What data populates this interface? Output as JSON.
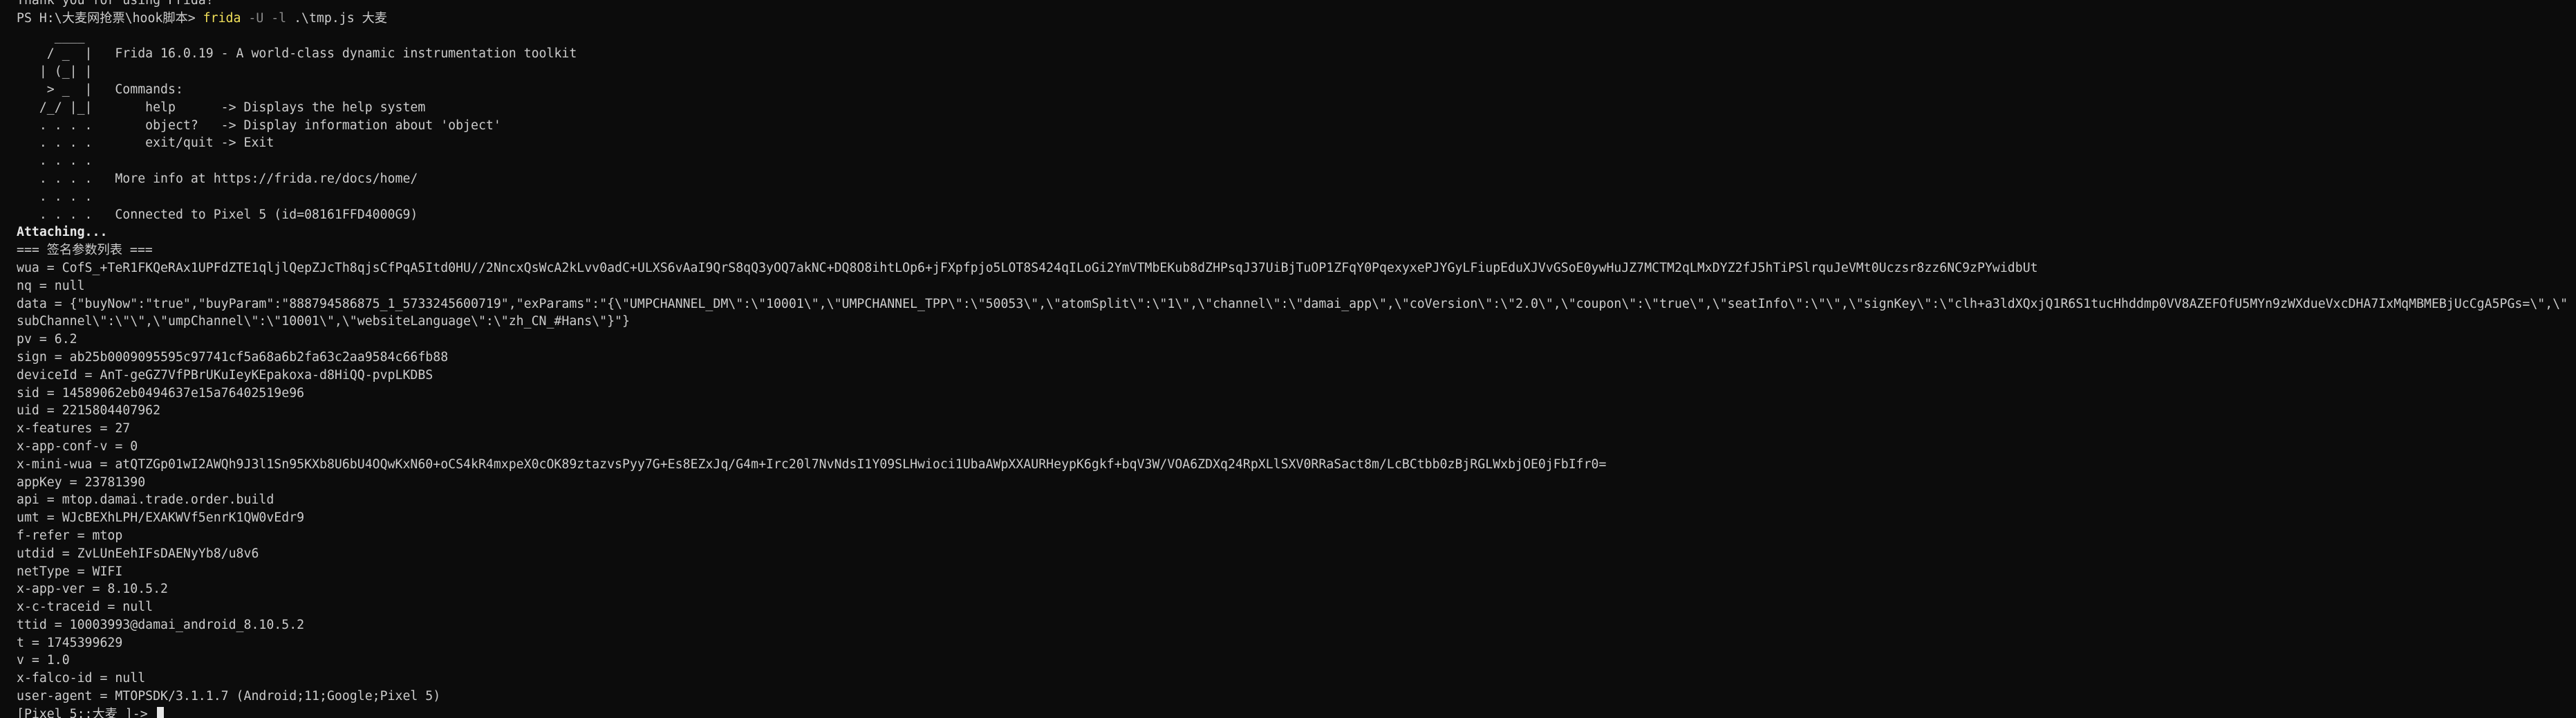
{
  "terminal": {
    "prev_line": "Thank you for using Frida!",
    "prompt": "PS H:\\大麦网抢票\\hook脚本> ",
    "command": {
      "name": "frida",
      "flag1": " -U -l",
      "rest": " .\\tmp.js 大麦"
    }
  },
  "banner": [
    {
      "art": "     ____   ",
      "text": ""
    },
    {
      "art": "    / _  |  ",
      "text": " Frida 16.0.19 - A world-class dynamic instrumentation toolkit"
    },
    {
      "art": "   | (_| |  ",
      "text": ""
    },
    {
      "art": "    > _  |  ",
      "text": " Commands:"
    },
    {
      "art": "   /_/ |_|  ",
      "text": "     help      -> Displays the help system"
    },
    {
      "art": "   . . . .  ",
      "text": "     object?   -> Display information about 'object'"
    },
    {
      "art": "   . . . .  ",
      "text": "     exit/quit -> Exit"
    },
    {
      "art": "   . . . .  ",
      "text": ""
    },
    {
      "art": "   . . . .  ",
      "text": " More info at https://frida.re/docs/home/"
    },
    {
      "art": "   . . . .  ",
      "text": ""
    },
    {
      "art": "   . . . .  ",
      "text": " Connected to Pixel 5 (id=08161FFD4000G9)"
    }
  ],
  "attaching": "Attaching...",
  "section_header": "=== 签名参数列表 ===",
  "output_lines": [
    "wua = CofS_+TeR1FKQeRAx1UPFdZTE1qljlQepZJcTh8qjsCfPqA5Itd0HU//2NncxQsWcA2kLvv0adC+ULXS6vAaI9QrS8qQ3yOQ7akNC+DQ8O8ihtLOp6+jFXpfpjo5LOT8S424qILoGi2YmVTMbEKub8dZHPsqJ37UiBjTuOP1ZFqY0PqexyxePJYGyLFiupEduXJVvGSoE0ywHuJZ7MCTM2qLMxDYZ2fJ5hTiPSlrquJeVMt0Uczsr8zz6NC9zPYwidbUt",
    "nq = null",
    "data = {\"buyNow\":\"true\",\"buyParam\":\"888794586875_1_5733245600719\",\"exParams\":\"{\\\"UMPCHANNEL_DM\\\":\\\"10001\\\",\\\"UMPCHANNEL_TPP\\\":\\\"50053\\\",\\\"atomSplit\\\":\\\"1\\\",\\\"channel\\\":\\\"damai_app\\\",\\\"coVersion\\\":\\\"2.0\\\",\\\"coupon\\\":\\\"true\\\",\\\"seatInfo\\\":\\\"\\\",\\\"signKey\\\":\\\"clh+a3ldXQxjQ1R6S1tucHhddmp0VV8AZEFOfU5MYn9zWXdueVxcDHA7IxMqMBMEBjUcCgA5PGs=\\\",\\\"",
    "subChannel\\\":\\\"\\\",\\\"umpChannel\\\":\\\"10001\\\",\\\"websiteLanguage\\\":\\\"zh_CN_#Hans\\\"}\"}",
    "pv = 6.2",
    "sign = ab25b0009095595c97741cf5a68a6b2fa63c2aa9584c66fb88",
    "deviceId = AnT-geGZ7VfPBrUKuIeyKEpakoxa-d8HiQQ-pvpLKDBS",
    "sid = 14589062eb0494637e15a76402519e96",
    "uid = 2215804407962",
    "x-features = 27",
    "x-app-conf-v = 0",
    "x-mini-wua = atQTZGp01wI2AWQh9J3l1Sn95KXb8U6bU4OQwKxN60+oCS4kR4mxpeX0cOK89ztazvsPyy7G+Es8EZxJq/G4m+Irc20l7NvNdsI1Y09SLHwioci1UbaAWpXXAURHeypK6gkf+bqV3W/VOA6ZDXq24RpXLlSXV0RRaSact8m/LcBCtbb0zBjRGLWxbjOE0jFbIfr0=",
    "appKey = 23781390",
    "api = mtop.damai.trade.order.build",
    "umt = WJcBEXhLPH/EXAKWVf5enrK1QW0vEdr9",
    "f-refer = mtop",
    "utdid = ZvLUnEehIFsDAENyYb8/u8v6",
    "netType = WIFI",
    "x-app-ver = 8.10.5.2",
    "x-c-traceid = null",
    "ttid = 10003993@damai_android_8.10.5.2",
    "t = 1745399629",
    "v = 1.0",
    "x-falco-id = null",
    "user-agent = MTOPSDK/3.1.1.7 (Android;11;Google;Pixel 5)"
  ],
  "final_prompt": "[Pixel 5::大麦 ]-> "
}
